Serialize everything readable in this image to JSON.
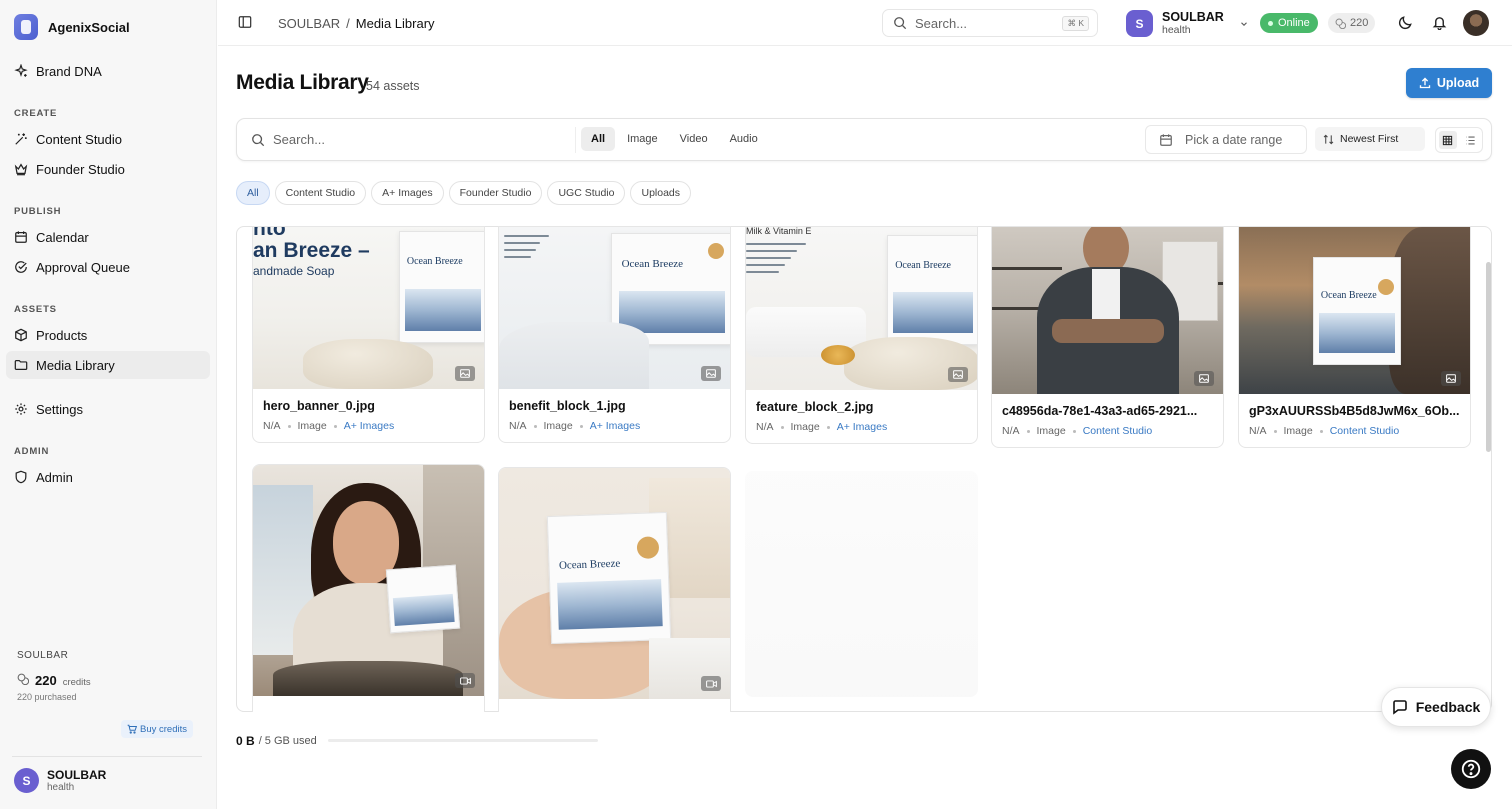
{
  "app": {
    "name": "AgenixSocial"
  },
  "sidebar": {
    "top_item": {
      "label": "Brand DNA",
      "icon": "sparkle-icon"
    },
    "sections": [
      {
        "title": "CREATE",
        "items": [
          {
            "label": "Content Studio",
            "icon": "wand-icon"
          },
          {
            "label": "Founder Studio",
            "icon": "crown-icon"
          }
        ]
      },
      {
        "title": "PUBLISH",
        "items": [
          {
            "label": "Calendar",
            "icon": "calendar-icon"
          },
          {
            "label": "Approval Queue",
            "icon": "check-circle-icon"
          }
        ]
      },
      {
        "title": "ASSETS",
        "items": [
          {
            "label": "Products",
            "icon": "box-icon"
          },
          {
            "label": "Media Library",
            "icon": "folder-icon"
          }
        ]
      },
      {
        "title": "",
        "items": [
          {
            "label": "Settings",
            "icon": "gear-icon"
          }
        ]
      },
      {
        "title": "ADMIN",
        "items": [
          {
            "label": "Admin",
            "icon": "shield-icon"
          }
        ]
      }
    ],
    "credits": {
      "owner": "SOULBAR",
      "amount": "220",
      "label": "credits",
      "purchased": "220 purchased",
      "buy_label": "Buy credits"
    },
    "user": {
      "initial": "S",
      "name": "SOULBAR",
      "sub": "health"
    }
  },
  "topbar": {
    "breadcrumb": {
      "parent": "SOULBAR",
      "separator": "/",
      "current": "Media Library"
    },
    "search_placeholder": "Search...",
    "shortcut": "⌘ K",
    "workspace": {
      "initial": "S",
      "name": "SOULBAR",
      "sub": "health"
    },
    "status": "Online",
    "credits": "220"
  },
  "page": {
    "title": "Media Library",
    "count": "54 assets",
    "upload_label": "Upload"
  },
  "filters": {
    "search_placeholder": "Search...",
    "types": [
      "All",
      "Image",
      "Video",
      "Audio"
    ],
    "active_type": "All",
    "date_placeholder": "Pick a date range",
    "sort": "Newest First",
    "sources": [
      "All",
      "Content Studio",
      "A+ Images",
      "Founder Studio",
      "UGC Studio",
      "Uploads"
    ],
    "active_source": "All"
  },
  "assets": [
    {
      "name": "hero_banner_0.jpg",
      "size": "N/A",
      "type": "Image",
      "source": "A+ Images",
      "media": "image",
      "headline_a": "nto",
      "headline_b": "an Breeze –",
      "sub": "andmade Soap",
      "box_label": "Ocean Breeze"
    },
    {
      "name": "benefit_block_1.jpg",
      "size": "N/A",
      "type": "Image",
      "source": "A+ Images",
      "media": "image",
      "box_label": "Ocean Breeze"
    },
    {
      "name": "feature_block_2.jpg",
      "size": "N/A",
      "type": "Image",
      "source": "A+ Images",
      "media": "image",
      "top_text": "Milk & Vitamin E",
      "box_label": "Ocean Breeze"
    },
    {
      "name": "c48956da-78e1-43a3-ad65-2921...",
      "size": "N/A",
      "type": "Image",
      "source": "Content Studio",
      "media": "image"
    },
    {
      "name": "gP3xAUURSSb4B5d8JwM6x_6Ob...",
      "size": "N/A",
      "type": "Image",
      "source": "Content Studio",
      "media": "image",
      "box_label": "Ocean Breeze"
    },
    {
      "name": "",
      "media": "video"
    },
    {
      "name": "",
      "media": "video",
      "box_label": "Ocean Breeze"
    }
  ],
  "storage": {
    "used": "0 B",
    "total": "/ 5 GB used",
    "fraction": 0
  },
  "feedback_label": "Feedback",
  "colors": {
    "primary": "#2f7fd0",
    "online": "#49b96a",
    "avatar": "#6a5fd0",
    "source_link": "#3a7ac4"
  }
}
